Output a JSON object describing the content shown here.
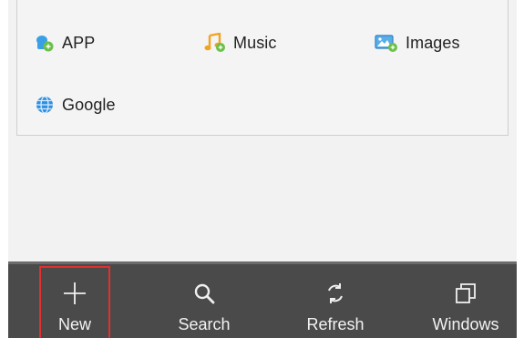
{
  "bookmarks": {
    "items": [
      {
        "label": "APP",
        "icon": "app-icon"
      },
      {
        "label": "Music",
        "icon": "music-icon"
      },
      {
        "label": "Images",
        "icon": "images-icon"
      },
      {
        "label": "Google",
        "icon": "globe-icon"
      }
    ]
  },
  "toolbar": {
    "new_label": "New",
    "search_label": "Search",
    "refresh_label": "Refresh",
    "windows_label": "Windows",
    "highlight_color": "#e0302f",
    "background_color": "#4a4a4a"
  }
}
